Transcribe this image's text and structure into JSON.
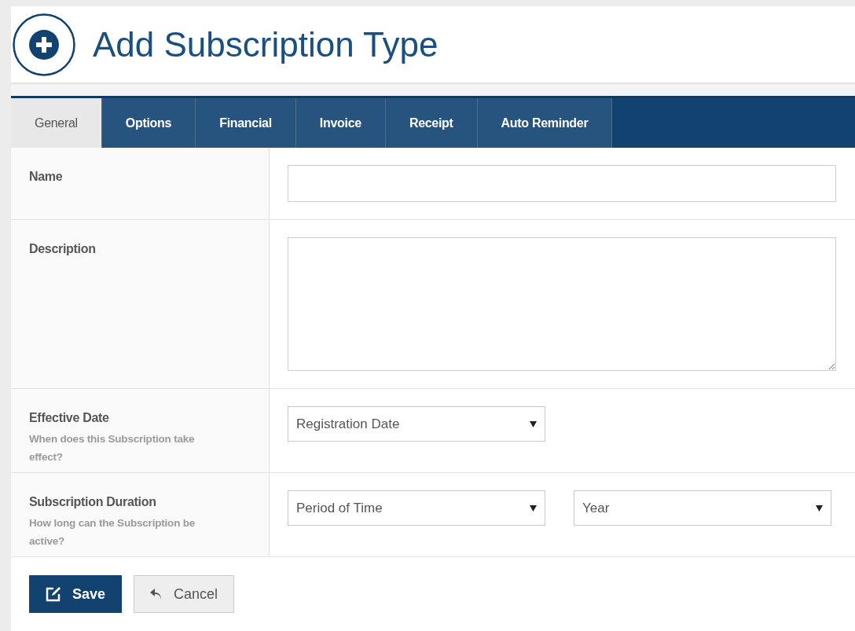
{
  "header": {
    "title": "Add Subscription Type"
  },
  "tabs": [
    {
      "label": "General",
      "selected": true
    },
    {
      "label": "Options",
      "selected": false
    },
    {
      "label": "Financial",
      "selected": false
    },
    {
      "label": "Invoice",
      "selected": false
    },
    {
      "label": "Receipt",
      "selected": false
    },
    {
      "label": "Auto Reminder",
      "selected": false
    }
  ],
  "rows": [
    {
      "label": "Name",
      "controls": [
        {
          "kind": "text"
        }
      ]
    },
    {
      "label": "Description",
      "controls": [
        {
          "kind": "textarea"
        }
      ]
    },
    {
      "label": "Effective Date",
      "help": "When does this Subscription take effect?",
      "controls": [
        {
          "kind": "select",
          "value": "Registration Date"
        }
      ]
    },
    {
      "label": "Subscription Duration",
      "help": "How long can the Subscription be active?",
      "controls": [
        {
          "kind": "select",
          "value": "Period of Time"
        },
        {
          "kind": "select",
          "value": "Year"
        }
      ]
    }
  ],
  "buttons": [
    {
      "label": "Save",
      "kind": "primary"
    },
    {
      "label": "Cancel",
      "kind": "secondary"
    }
  ]
}
